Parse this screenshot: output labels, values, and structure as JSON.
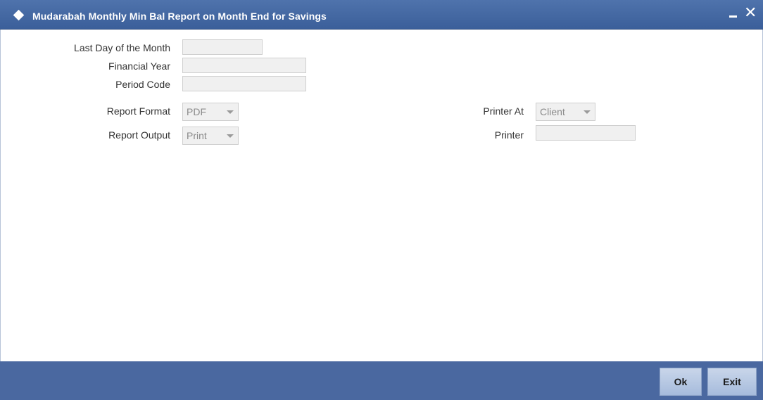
{
  "window": {
    "title": "Mudarabah Monthly Min Bal Report on Month End for Savings",
    "close_glyph": "✕",
    "accent_color": "#3b5f9a"
  },
  "form": {
    "last_day_label": "Last Day of the Month",
    "last_day_value": "",
    "financial_year_label": "Financial Year",
    "financial_year_value": "",
    "period_code_label": "Period Code",
    "period_code_value": "",
    "report_format_label": "Report Format",
    "report_format_value": "PDF",
    "report_output_label": "Report Output",
    "report_output_value": "Print",
    "printer_at_label": "Printer At",
    "printer_at_value": "Client",
    "printer_label": "Printer",
    "printer_value": ""
  },
  "footer": {
    "ok_label": "Ok",
    "exit_label": "Exit"
  },
  "icons": {
    "title": "diamond-icon",
    "minimize": "minimize-icon",
    "close": "close-icon",
    "dropdown": "chevron-down-icon"
  }
}
